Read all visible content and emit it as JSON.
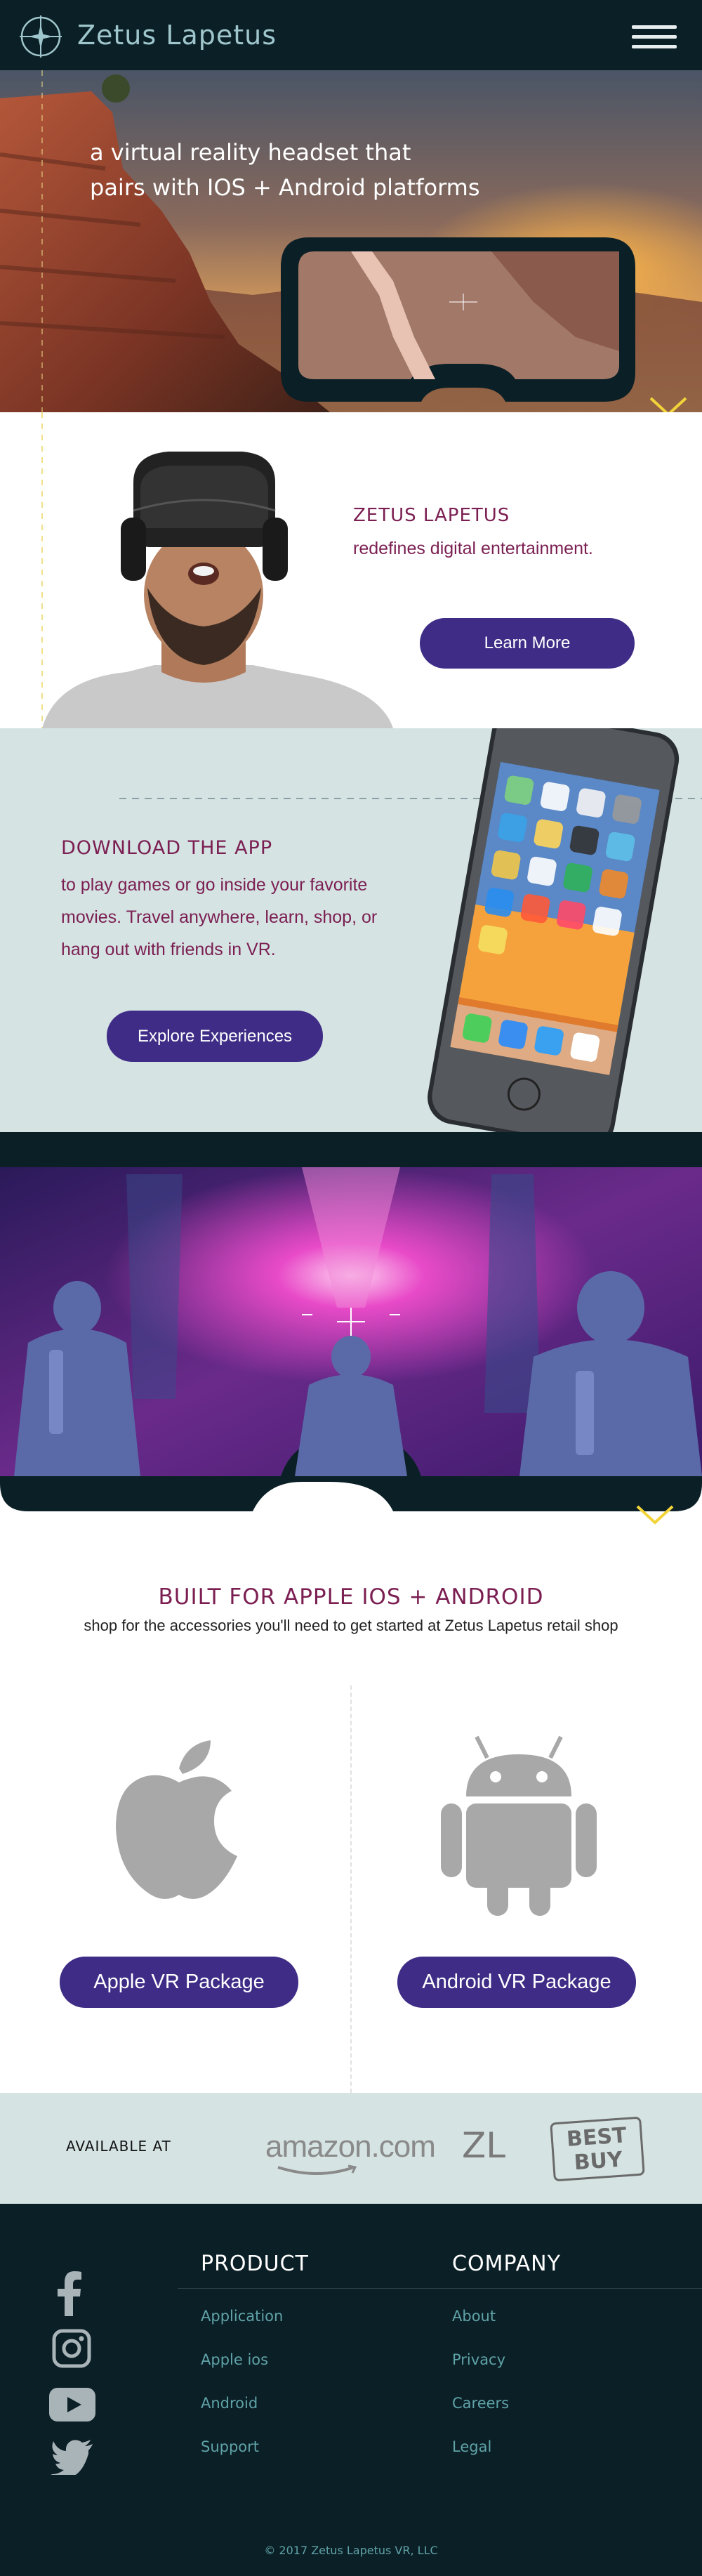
{
  "header": {
    "logo_text": "Zetus Lapetus",
    "logo_icon": "compass-crosshair-icon",
    "menu_icon": "hamburger-menu-icon"
  },
  "hero": {
    "line1": "a virtual reality headset that",
    "line2": "pairs with IOS + Android platforms",
    "scroll_icon": "chevron-down-icon"
  },
  "intro": {
    "brand": "ZETUS LAPETUS",
    "tagline": "redefines digital entertainment.",
    "button": "Learn More"
  },
  "app": {
    "title": "DOWNLOAD THE APP",
    "line1": "to play games or go inside your favorite",
    "line2": "movies. Travel anywhere, learn, shop, or",
    "line3": "hang out with friends in VR.",
    "button": "Explore Experiences"
  },
  "built": {
    "title": "BUILT FOR APPLE IOS + ANDROID",
    "subtitle": "shop for the accessories you'll need to get started at Zetus Lapetus retail shop",
    "apple_button": "Apple VR Package",
    "android_button": "Android VR Package",
    "apple_icon": "apple-logo-icon",
    "android_icon": "android-robot-icon"
  },
  "available": {
    "label": "AVAILABLE AT",
    "amazon": "amazon.com",
    "zl": "ZL",
    "bestbuy_line1": "BEST",
    "bestbuy_line2": "BUY"
  },
  "footer": {
    "product_heading": "PRODUCT",
    "company_heading": "COMPANY",
    "product_links": [
      "Application",
      "Apple ios",
      "Android",
      "Support"
    ],
    "company_links": [
      "About",
      "Privacy",
      "Careers",
      "Legal"
    ],
    "social_icons": [
      "facebook-icon",
      "instagram-icon",
      "youtube-icon",
      "twitter-icon"
    ],
    "copyright": "© 2017 Zetus Lapetus VR, LLC"
  },
  "colors": {
    "dark": "#0b1f26",
    "accent_purple": "#3f2c86",
    "brand_maroon": "#7b1f52",
    "pale_teal": "#d5e3e3",
    "link_teal": "#5fa3a8",
    "chevron_yellow": "#f2d43a"
  }
}
